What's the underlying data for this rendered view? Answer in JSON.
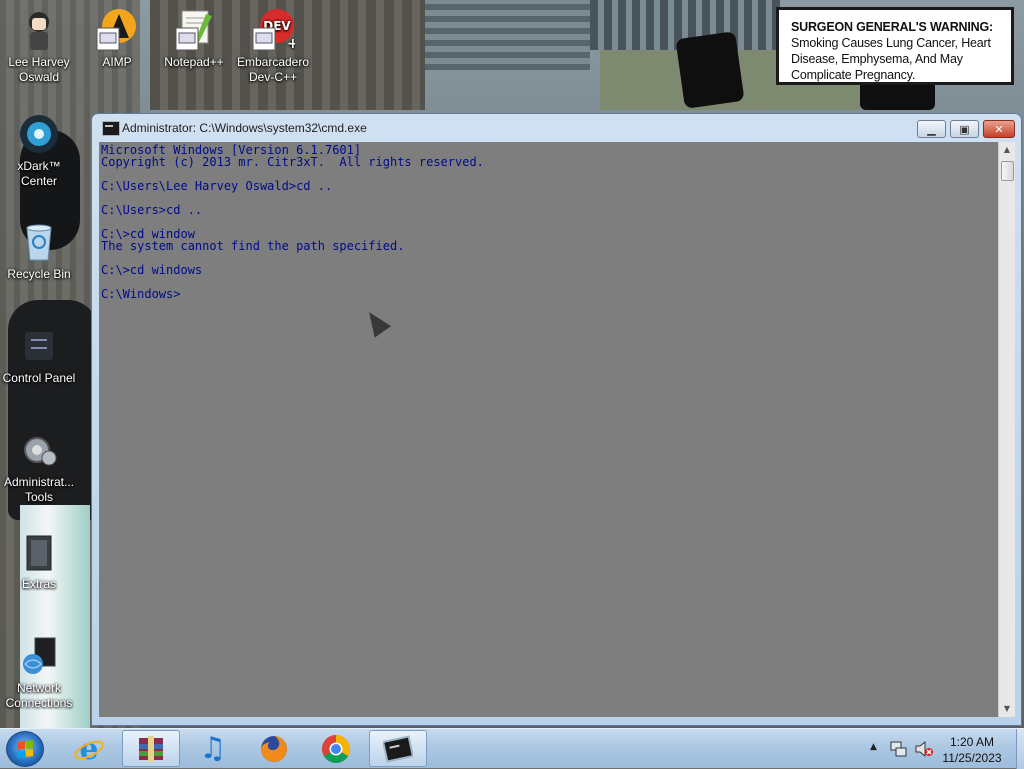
{
  "desktop": {
    "icons": [
      {
        "label": "Lee Harvey Oswald",
        "icon": "user-folder-icon"
      },
      {
        "label": "AIMP",
        "icon": "aimp-icon"
      },
      {
        "label": "Notepad++",
        "icon": "notepad-plus-plus-icon"
      },
      {
        "label": "Embarcadero Dev-C++",
        "icon": "dev-cpp-icon"
      },
      {
        "label": "xDark™ Center",
        "icon": "xdark-center-icon"
      },
      {
        "label": "Recycle Bin",
        "icon": "recycle-bin-icon"
      },
      {
        "label": "Control Panel",
        "icon": "control-panel-icon"
      },
      {
        "label": "Administrat... Tools",
        "icon": "administrative-tools-icon"
      },
      {
        "label": "Extras",
        "icon": "extras-folder-icon"
      },
      {
        "label": "Network Connections",
        "icon": "network-connections-icon"
      }
    ],
    "wallpaper_sign": {
      "bold": "SURGEON GENERAL'S WARNING:",
      "text": " Smoking Causes Lung Cancer, Heart Disease, Emphysema, And May Complicate Pregnancy."
    }
  },
  "window": {
    "title": "Administrator: C:\\Windows\\system32\\cmd.exe",
    "minimize_glyph": "▁",
    "maximize_glyph": "▣",
    "close_glyph": "✕",
    "console_lines": [
      "Microsoft Windows [Version 6.1.7601]",
      "Copyright (c) 2013 mr. Citr3xT.  All rights reserved.",
      "",
      "C:\\Users\\Lee Harvey Oswald>cd ..",
      "",
      "C:\\Users>cd ..",
      "",
      "C:\\>cd window",
      "The system cannot find the path specified.",
      "",
      "C:\\>cd windows",
      "",
      "C:\\Windows>"
    ],
    "colors": {
      "console_bg": "#7e7e7e",
      "console_fg": "#000c8a"
    }
  },
  "taskbar": {
    "pinned": [
      {
        "name": "internet-explorer-icon",
        "glyph": "e"
      },
      {
        "name": "winrar-icon",
        "glyph": ""
      },
      {
        "name": "music-player-icon",
        "glyph": "♫"
      },
      {
        "name": "firefox-icon",
        "glyph": ""
      },
      {
        "name": "chrome-icon",
        "glyph": ""
      },
      {
        "name": "cmd-taskbar-icon",
        "glyph": ""
      }
    ],
    "tray": {
      "time": "1:20 AM",
      "date": "11/25/2023",
      "show_hidden_glyph": "▲"
    }
  }
}
